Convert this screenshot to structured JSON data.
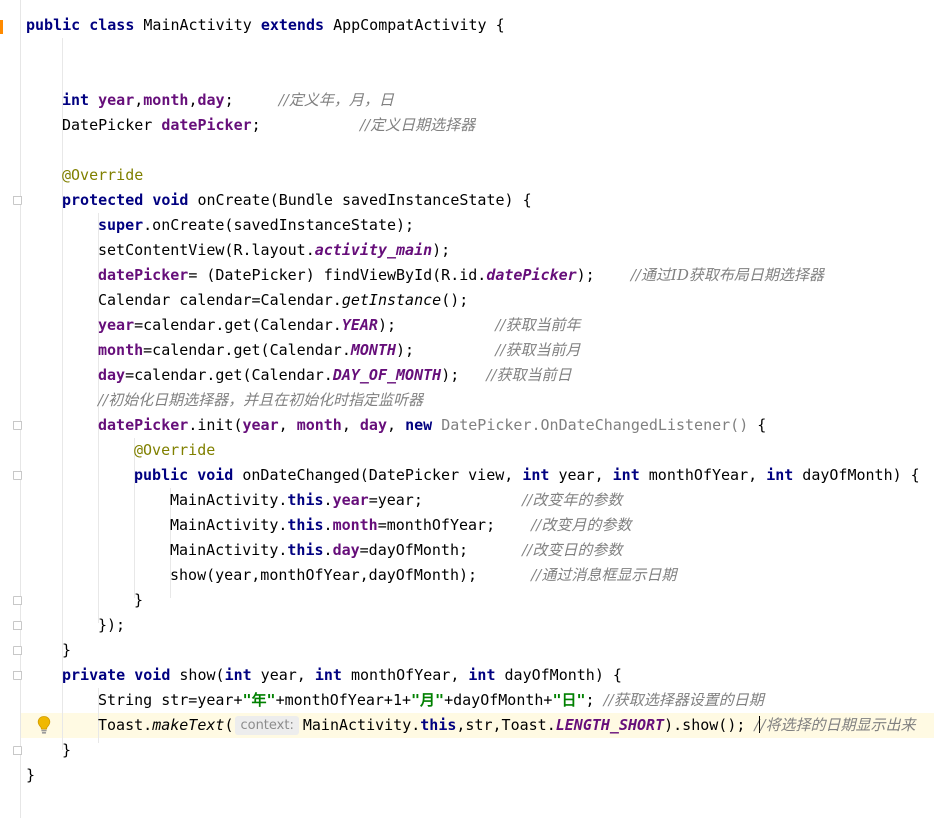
{
  "code": {
    "l1": {
      "kw1": "public",
      "kw2": "class",
      "name": "MainActivity",
      "kw3": "extends",
      "parent": "AppCompatActivity",
      "brace": "{"
    },
    "l2": {
      "kw": "int",
      "v1": "year",
      "c1": ",",
      "v2": "month",
      "c2": ",",
      "v3": "day",
      "semi": ";",
      "comment": "//定义年，月，日"
    },
    "l3": {
      "type": "DatePicker",
      "field": "datePicker",
      "semi": ";",
      "comment": "//定义日期选择器"
    },
    "l4": {
      "ann": "@Override"
    },
    "l5": {
      "kw1": "protected",
      "kw2": "void",
      "rest": "onCreate(Bundle savedInstanceState) {"
    },
    "l6": {
      "kw": "super",
      "rest": ".onCreate(savedInstanceState);"
    },
    "l7": {
      "pre": "setContentView(R.layout.",
      "sfield": "activity_main",
      "post": ");"
    },
    "l8": {
      "field": "datePicker",
      "mid": "= (DatePicker) findViewById(R.id.",
      "sfield": "datePicker",
      "post": ");",
      "comment": "//通过ID获取布局日期选择器"
    },
    "l9": {
      "pre": "Calendar calendar=Calendar.",
      "method": "getInstance",
      "post": "();"
    },
    "l10": {
      "field": "year",
      "mid": "=calendar.get(Calendar.",
      "sfield": "YEAR",
      "post": ");",
      "comment": "//获取当前年"
    },
    "l11": {
      "field": "month",
      "mid": "=calendar.get(Calendar.",
      "sfield": "MONTH",
      "post": ");",
      "comment": "//获取当前月"
    },
    "l12": {
      "field": "day",
      "mid": "=calendar.get(Calendar.",
      "sfield": "DAY_OF_MONTH",
      "post": ");",
      "comment": "//获取当前日"
    },
    "l13": {
      "comment": "//初始化日期选择器，并且在初始化时指定监听器"
    },
    "l14": {
      "field": "datePicker",
      "dot": ".init(",
      "f1": "year",
      "sep1": ", ",
      "f2": "month",
      "sep2": ", ",
      "f3": "day",
      "sep3": ", ",
      "kw": "new",
      "inactive": "DatePicker.OnDateChangedListener()",
      "post": " {"
    },
    "l15": {
      "ann": "@Override"
    },
    "l16": {
      "kw1": "public",
      "kw2": "void",
      "pre": "onDateChanged(DatePicker view, ",
      "kw3": "int",
      "p1": " year, ",
      "kw4": "int",
      "p2": " monthOfYear, ",
      "kw5": "int",
      "p3": " dayOfMonth) {"
    },
    "l17": {
      "pre": "MainActivity.",
      "kw": "this",
      "dot": ".",
      "field": "year",
      "post": "=year;",
      "comment": "//改变年的参数"
    },
    "l18": {
      "pre": "MainActivity.",
      "kw": "this",
      "dot": ".",
      "field": "month",
      "post": "=monthOfYear;",
      "comment": "//改变月的参数"
    },
    "l19": {
      "pre": "MainActivity.",
      "kw": "this",
      "dot": ".",
      "field": "day",
      "post": "=dayOfMonth;",
      "comment": "//改变日的参数"
    },
    "l20": {
      "text": "show(year,monthOfYear,dayOfMonth);",
      "comment": "//通过消息框显示日期"
    },
    "l21": {
      "text": "}"
    },
    "l22": {
      "text": "});"
    },
    "l23": {
      "text": "}"
    },
    "l24": {
      "kw1": "private",
      "kw2": "void",
      "pre": "show(",
      "kw3": "int",
      "p1": " year, ",
      "kw4": "int",
      "p2": " monthOfYear, ",
      "kw5": "int",
      "p3": " dayOfMonth) {"
    },
    "l25": {
      "pre": "String str=year+",
      "s1": "\"年\"",
      "m1": "+monthOfYear+1+",
      "s2": "\"月\"",
      "m2": "+dayOfMonth+",
      "s3": "\"日\"",
      "post": ";",
      "comment": "//获取选择器设置的日期"
    },
    "l26": {
      "pre": "Toast.",
      "method": "makeText",
      "paren": "(",
      "hint": "context:",
      "mid": "MainActivity.",
      "kw": "this",
      "mid2": ",str,Toast.",
      "sfield": "LENGTH_SHORT",
      "post": ").show();",
      "c1": "/",
      "comment": "/将选择的日期显示出来"
    },
    "l27": {
      "text": "}"
    },
    "l28": {
      "text": "}"
    }
  },
  "colors": {
    "keyword": "#000080",
    "field": "#660e7a",
    "comment": "#808080",
    "annotation": "#808000",
    "string": "#008000",
    "caret_line": "#fffae3",
    "change_marker": "#ff8a00"
  },
  "icons": {
    "intention": "lightbulb-icon"
  }
}
